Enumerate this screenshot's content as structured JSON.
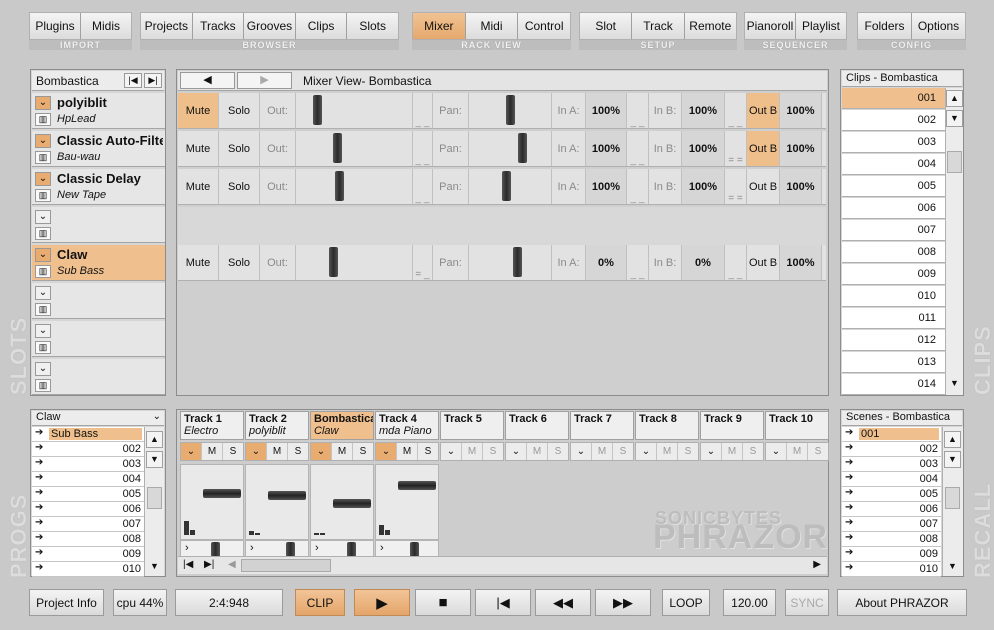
{
  "topbar": {
    "groups": [
      {
        "label": "IMPORT",
        "buttons": [
          "Plugins",
          "Midis"
        ]
      },
      {
        "label": "BROWSER",
        "buttons": [
          "Projects",
          "Tracks",
          "Grooves",
          "Clips",
          "Slots"
        ]
      },
      {
        "label": "RACK VIEW",
        "buttons": [
          "Mixer",
          "Midi",
          "Control"
        ]
      },
      {
        "label": "SETUP",
        "buttons": [
          "Slot",
          "Track",
          "Remote"
        ]
      },
      {
        "label": "SEQUENCER",
        "buttons": [
          "Pianoroll",
          "Playlist"
        ]
      },
      {
        "label": "CONFIG",
        "buttons": [
          "Folders",
          "Options"
        ]
      }
    ],
    "active_button": "Mixer"
  },
  "side_labels": {
    "slots": "SLOTS",
    "clips": "CLIPS",
    "progs": "PROGS",
    "recall": "RECALL"
  },
  "slots_panel": {
    "title": "Bombastica",
    "nav_prev": "|◀",
    "nav_next": "▶|",
    "slots": [
      {
        "name": "polyiblit",
        "sub": "HpLead",
        "active": false
      },
      {
        "name": "Classic Auto-Filter",
        "sub": "Bau-wau",
        "active": false
      },
      {
        "name": "Classic Delay",
        "sub": "New Tape",
        "active": false
      },
      {
        "name": "",
        "sub": "",
        "active": false
      },
      {
        "name": "Claw",
        "sub": "Sub Bass",
        "active": true
      },
      {
        "name": "",
        "sub": "",
        "active": false
      },
      {
        "name": "",
        "sub": "",
        "active": false
      },
      {
        "name": "",
        "sub": "",
        "active": false
      }
    ]
  },
  "mixer": {
    "back": "◀",
    "forward": "▶",
    "title": "Mixer View- Bombastica",
    "labels": {
      "mute": "Mute",
      "solo": "Solo",
      "out": "Out:",
      "pan": "Pan:",
      "in_a": "In A:",
      "in_b": "In B:",
      "out_b": "Out B"
    },
    "rows": [
      {
        "mute_on": true,
        "out_level": 0.12,
        "pan": 0.5,
        "in_a": "100%",
        "in_b": "100%",
        "out_b_on": true,
        "out_b": "100%",
        "mark1": "_ _",
        "mark2": "_ _",
        "mark3": "_ _"
      },
      {
        "mute_on": false,
        "out_level": 0.33,
        "pan": 0.7,
        "in_a": "100%",
        "in_b": "100%",
        "out_b_on": true,
        "out_b": "100%",
        "mark1": "_ _",
        "mark2": "_ _",
        "mark3": "= ="
      },
      {
        "mute_on": false,
        "out_level": 0.35,
        "pan": 0.45,
        "in_a": "100%",
        "in_b": "100%",
        "out_b_on": false,
        "out_b": "100%",
        "mark1": "_ _",
        "mark2": "_ _",
        "mark3": "= ="
      },
      null,
      {
        "mute_on": false,
        "out_level": 0.29,
        "pan": 0.62,
        "in_a": "0%",
        "in_b": "0%",
        "out_b_on": false,
        "out_b": "100%",
        "mark1": "= _",
        "mark2": "_ _",
        "mark3": "_ _"
      }
    ]
  },
  "clips_panel": {
    "title": "Clips - Bombastica",
    "items": [
      "001",
      "002",
      "003",
      "004",
      "005",
      "006",
      "007",
      "008",
      "009",
      "010",
      "011",
      "012",
      "013",
      "014"
    ],
    "selected": "001"
  },
  "progs_panel": {
    "title": "Claw",
    "items": [
      "Sub Bass",
      "002",
      "003",
      "004",
      "005",
      "006",
      "007",
      "008",
      "009",
      "010"
    ],
    "selected": "Sub Bass"
  },
  "tracks": [
    {
      "name": "Track 1",
      "inst": "Electro",
      "active": false,
      "ms": true
    },
    {
      "name": "Track 2",
      "inst": "polyiblit",
      "active": false,
      "ms": true
    },
    {
      "name": "Bombastica",
      "inst": "Claw",
      "active": true,
      "ms": true
    },
    {
      "name": "Track 4",
      "inst": "mda Piano",
      "active": false,
      "ms": true
    },
    {
      "name": "Track 5",
      "inst": "",
      "active": false,
      "ms": false
    },
    {
      "name": "Track 6",
      "inst": "",
      "active": false,
      "ms": false
    },
    {
      "name": "Track 7",
      "inst": "",
      "active": false,
      "ms": false
    },
    {
      "name": "Track 8",
      "inst": "",
      "active": false,
      "ms": false
    },
    {
      "name": "Track 9",
      "inst": "",
      "active": false,
      "ms": false
    },
    {
      "name": "Track 10",
      "inst": "",
      "active": false,
      "ms": false
    }
  ],
  "track_ms_labels": {
    "chev": "⌄",
    "m": "M",
    "s": "S"
  },
  "logo": {
    "line1": "SONICBYTES",
    "line2": "PHRAZOR"
  },
  "scenes_panel": {
    "title": "Scenes - Bombastica",
    "items": [
      "001",
      "002",
      "003",
      "004",
      "005",
      "006",
      "007",
      "008",
      "009",
      "010"
    ],
    "selected": "001"
  },
  "transport": {
    "project_info": "Project Info",
    "cpu": "cpu 44%",
    "position": "2:4:948",
    "clip": "CLIP",
    "play": "▶",
    "stop": "■",
    "to_start": "|◀",
    "rewind": "◀◀",
    "forward": "▶▶",
    "loop": "LOOP",
    "tempo": "120.00",
    "sync": "SYNC",
    "about": "About PHRAZOR"
  },
  "colors": {
    "accent": "#efbf8b",
    "background": "#c9c9c9"
  }
}
